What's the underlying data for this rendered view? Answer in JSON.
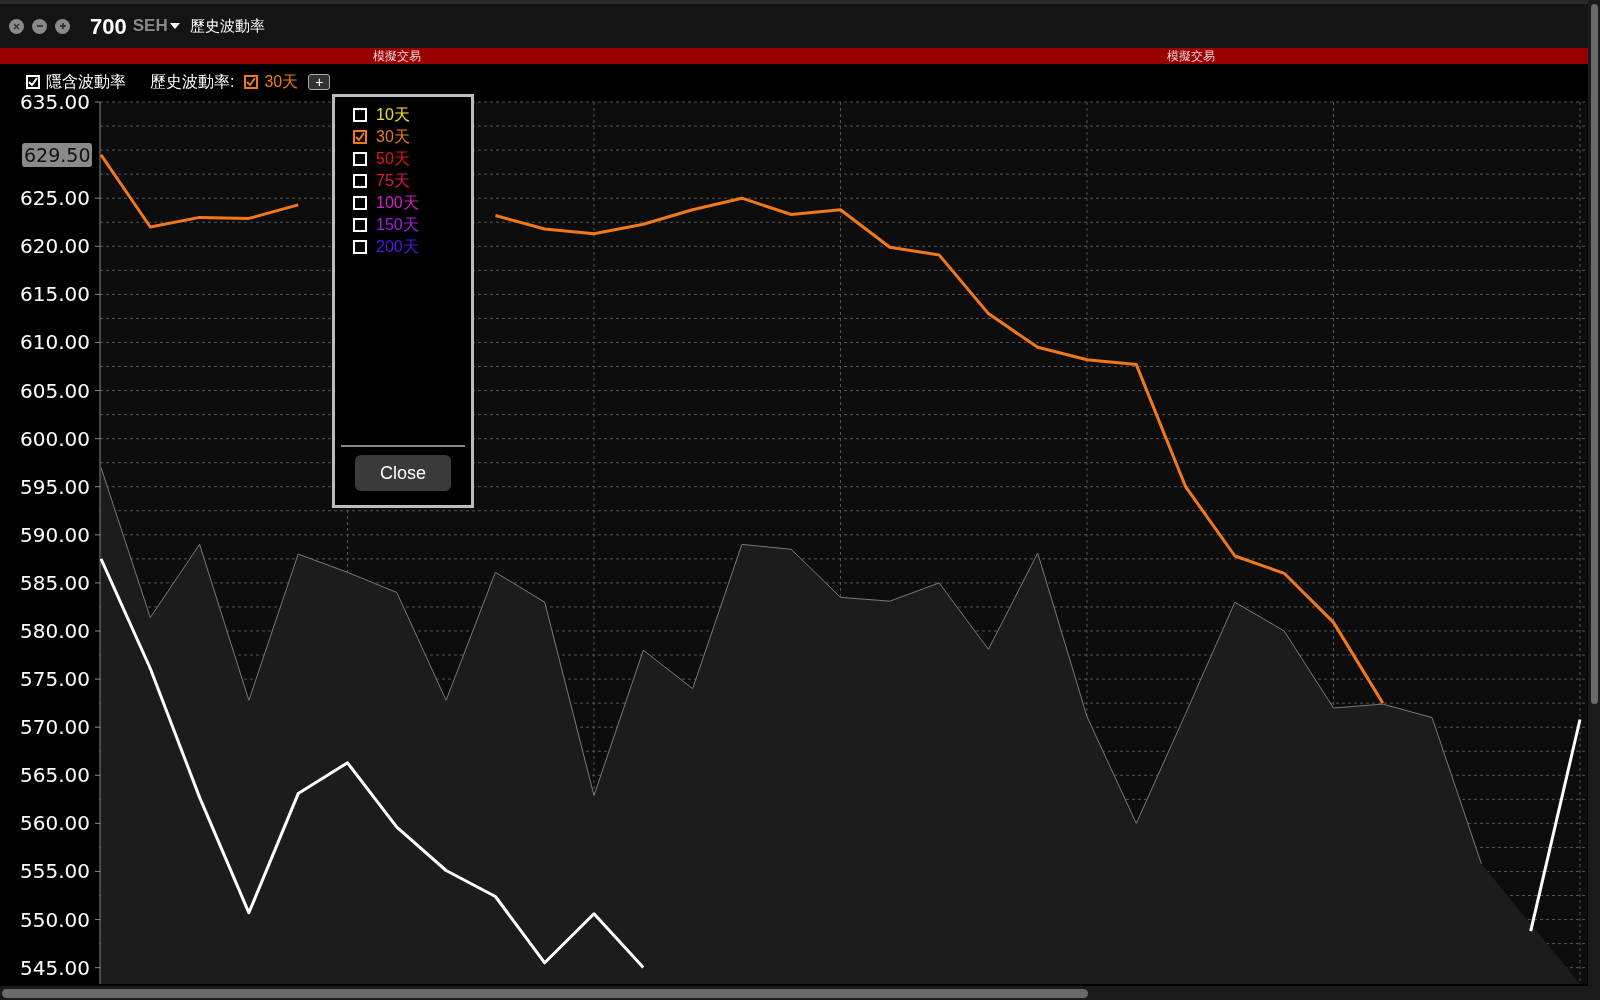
{
  "window": {
    "symbol": "700",
    "exchange": "SEH",
    "title": "歷史波動率"
  },
  "banner": {
    "labels": [
      "模擬交易",
      "模擬交易"
    ]
  },
  "toolbar": {
    "implied": {
      "label": "隱含波動率",
      "checked": true
    },
    "historical_label": "歷史波動率:",
    "historical": {
      "label": "30天",
      "checked": true,
      "color": "#f07a1a"
    },
    "add_button": "+"
  },
  "price_tag": "629.50",
  "chart_data": {
    "type": "line",
    "grid": true,
    "ylim": [
      543.3,
      635
    ],
    "yticks": [
      {
        "value": 635,
        "label": "635.00"
      },
      {
        "value": 625,
        "label": "625.00"
      },
      {
        "value": 620,
        "label": "620.00"
      },
      {
        "value": 615,
        "label": "615.00"
      },
      {
        "value": 610,
        "label": "610.00"
      },
      {
        "value": 605,
        "label": "605.00"
      },
      {
        "value": 600,
        "label": "600.00"
      },
      {
        "value": 595,
        "label": "595.00"
      },
      {
        "value": 590,
        "label": "590.00"
      },
      {
        "value": 585,
        "label": "585.00"
      },
      {
        "value": 580,
        "label": "580.00"
      },
      {
        "value": 575,
        "label": "575.00"
      },
      {
        "value": 570,
        "label": "570.00"
      },
      {
        "value": 565,
        "label": "565.00"
      },
      {
        "value": 560,
        "label": "560.00"
      },
      {
        "value": 555,
        "label": "555.00"
      },
      {
        "value": 550,
        "label": "550.00"
      },
      {
        "value": 545,
        "label": "545.00"
      }
    ],
    "categories": [
      null,
      null,
      null,
      null,
      null,
      null,
      null,
      null,
      null,
      null,
      null,
      null,
      null,
      null,
      null,
      null,
      null,
      null,
      null,
      null,
      null,
      null,
      null,
      null,
      null,
      null,
      null,
      null,
      null,
      null,
      null
    ],
    "series": [
      {
        "color": "#7a7a7a",
        "values": [
          597.0,
          581.4,
          589.0,
          572.8,
          588.0,
          586.1,
          584.0,
          572.8,
          586.1,
          583.0,
          562.9,
          578.0,
          574.0,
          589.0,
          588.5,
          583.5,
          583.1,
          585.0,
          578.1,
          588.1,
          571.1,
          560.0,
          571.4,
          583.0,
          580.0,
          572.0,
          572.4,
          571.0,
          555.8,
          null,
          null
        ]
      },
      {
        "color": "#ffffff",
        "values": [
          587.5,
          576.1,
          562.7,
          550.7,
          563.1,
          566.3,
          559.6,
          555.1,
          552.4,
          545.5,
          550.6,
          545.0,
          null,
          null,
          null,
          null,
          null,
          null,
          null,
          null,
          null,
          null,
          null,
          null,
          null,
          null,
          null,
          null,
          null,
          548.8,
          570.8
        ]
      },
      {
        "color": "#f07a1a",
        "values": [
          629.5,
          622.0,
          623.0,
          622.9,
          624.3,
          null,
          null,
          null,
          623.2,
          621.8,
          621.3,
          622.3,
          623.8,
          625.0,
          623.3,
          623.8,
          619.9,
          619.1,
          613.0,
          609.5,
          608.2,
          607.7,
          595.0,
          587.8,
          586.0,
          580.9,
          572.5,
          null,
          null,
          null,
          null
        ]
      }
    ]
  },
  "popup": {
    "items": [
      {
        "label": "10天",
        "checked": false,
        "color": "#e8e020"
      },
      {
        "label": "30天",
        "checked": true,
        "color": "#f07a1a"
      },
      {
        "label": "50天",
        "checked": false,
        "color": "#e01818"
      },
      {
        "label": "75天",
        "checked": false,
        "color": "#e0184a"
      },
      {
        "label": "100天",
        "checked": false,
        "color": "#d81ec8"
      },
      {
        "label": "150天",
        "checked": false,
        "color": "#a020e0"
      },
      {
        "label": "200天",
        "checked": false,
        "color": "#4a18e0"
      }
    ],
    "close_button": "Close"
  }
}
